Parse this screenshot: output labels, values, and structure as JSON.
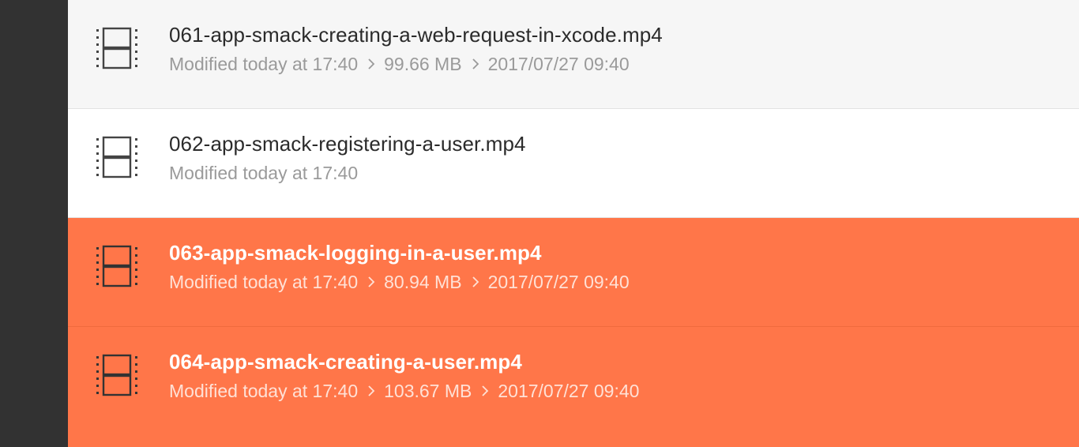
{
  "colors": {
    "sidebar": "#323232",
    "selection": "#ff7649",
    "row_alt": "#f6f6f6",
    "text_primary": "#2b2b2b",
    "text_secondary": "#9a9a9a"
  },
  "files": [
    {
      "icon": "video-file-icon",
      "name": "061-app-smack-creating-a-web-request-in-xcode.mp4",
      "modified": "Modified today at 17:40",
      "size": "99.66 MB",
      "date": "2017/07/27 09:40",
      "selected": false
    },
    {
      "icon": "video-file-icon",
      "name": "062-app-smack-registering-a-user.mp4",
      "modified": "Modified today at 17:40",
      "size": "",
      "date": "",
      "selected": false
    },
    {
      "icon": "video-file-icon",
      "name": "063-app-smack-logging-in-a-user.mp4",
      "modified": "Modified today at 17:40",
      "size": "80.94 MB",
      "date": "2017/07/27 09:40",
      "selected": true
    },
    {
      "icon": "video-file-icon",
      "name": "064-app-smack-creating-a-user.mp4",
      "modified": "Modified today at 17:40",
      "size": "103.67 MB",
      "date": "2017/07/27 09:40",
      "selected": true
    }
  ]
}
